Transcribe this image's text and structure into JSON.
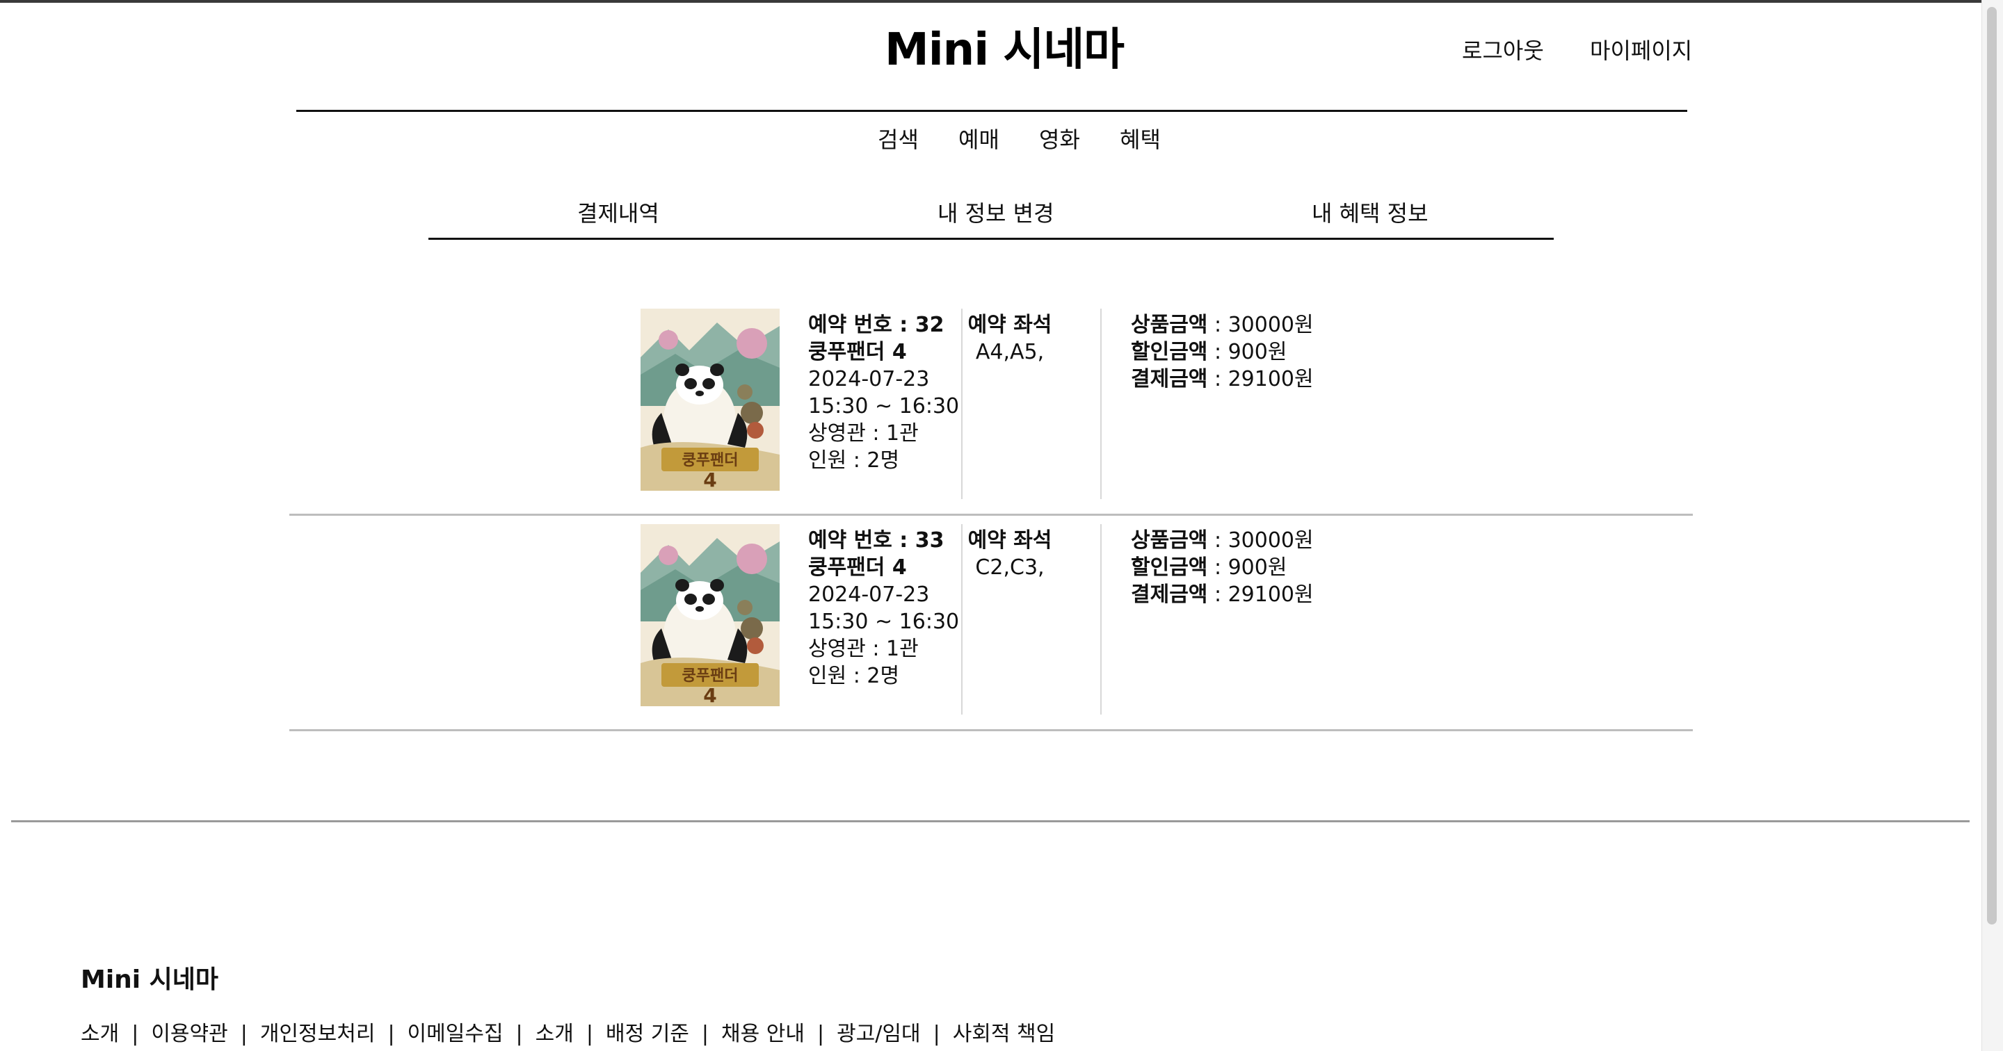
{
  "header": {
    "logo": "Mini 시네마",
    "logout": "로그아웃",
    "mypage": "마이페이지"
  },
  "nav": {
    "items": [
      "검색",
      "예매",
      "영화",
      "혜택"
    ]
  },
  "mypage_tabs": [
    "결제내역",
    "내 정보 변경",
    "내 혜택 정보"
  ],
  "reservations": [
    {
      "reservation_no": "예약 번호 : 32",
      "title": "쿵푸팬더 4",
      "date": "2024-07-23",
      "time": "15:30 ~ 16:30",
      "hall": "상영관 : 1관",
      "people": "인원 : 2명",
      "seat_label": "예약 좌석",
      "seats": "A4,A5,",
      "price_label": "상품금액",
      "price_value": " : 30000원",
      "discount_label": "할인금액",
      "discount_value": " : 900원",
      "pay_label": "결제금액",
      "pay_value": " : 29100원"
    },
    {
      "reservation_no": "예약 번호 : 33",
      "title": "쿵푸팬더 4",
      "date": "2024-07-23",
      "time": "15:30 ~ 16:30",
      "hall": "상영관 : 1관",
      "people": "인원 : 2명",
      "seat_label": "예약 좌석",
      "seats": "C2,C3,",
      "price_label": "상품금액",
      "price_value": " : 30000원",
      "discount_label": "할인금액",
      "discount_value": " : 900원",
      "pay_label": "결제금액",
      "pay_value": " : 29100원"
    }
  ],
  "poster": {
    "title_text": "쿵푸팬더",
    "number_text": "4"
  },
  "footer": {
    "title": "Mini 시네마",
    "separator": "|",
    "links": [
      "소개",
      "이용약관",
      "개인정보처리",
      "이메일수집",
      "소개",
      "배정 기준",
      "채용 안내",
      "광고/임대",
      "사회적 책임"
    ]
  }
}
